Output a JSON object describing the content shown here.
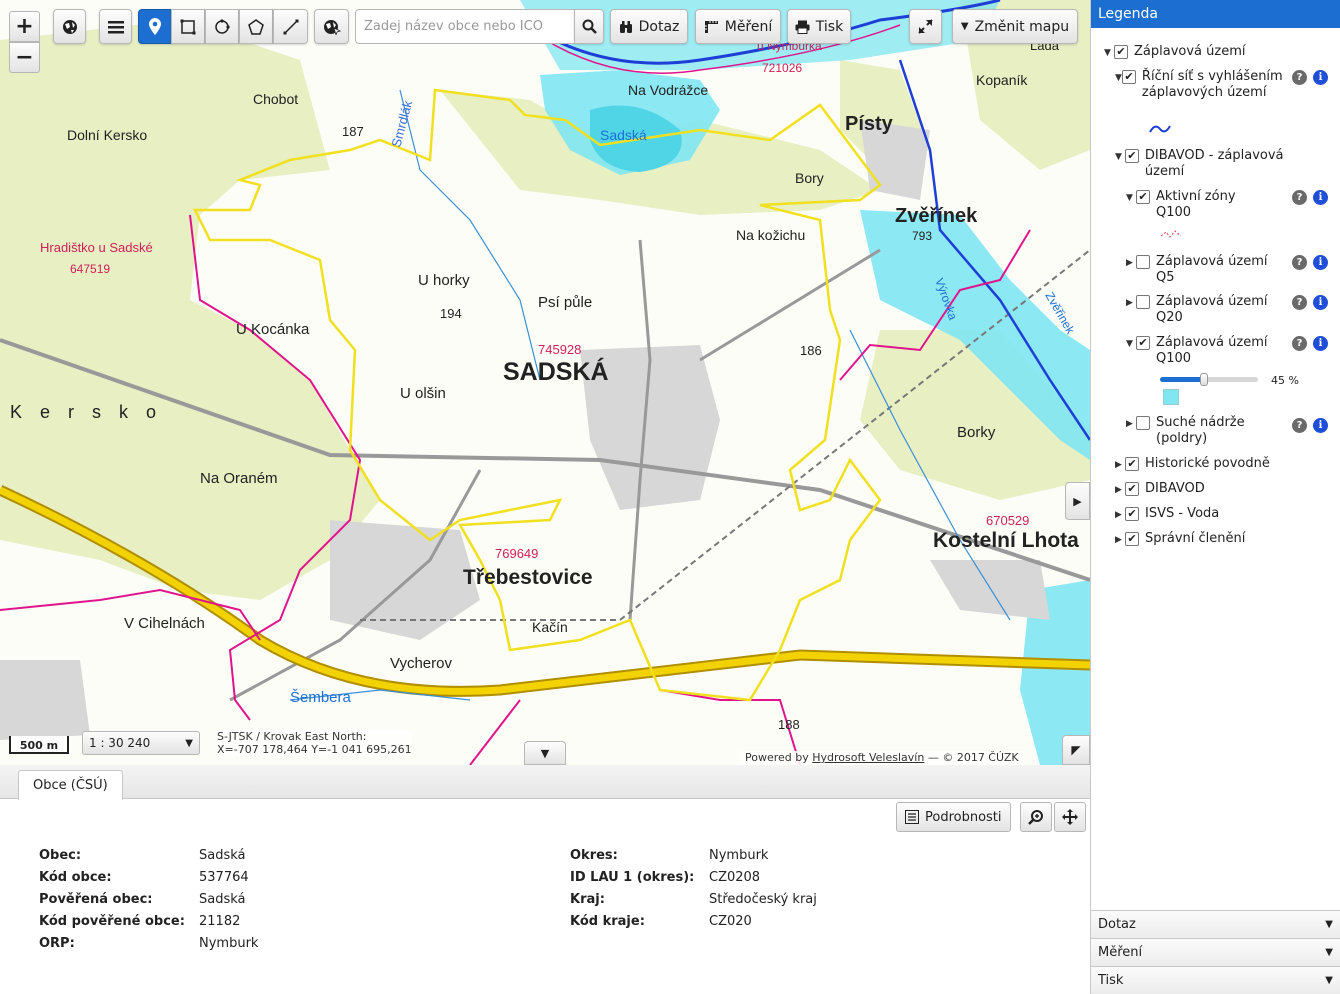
{
  "toolbar": {
    "zoom_in": "+",
    "zoom_out": "−",
    "search_placeholder": "Zadej název obce nebo IČO",
    "query_label": "Dotaz",
    "measure_label": "Měření",
    "print_label": "Tisk",
    "change_map_label": "Změnit mapu"
  },
  "map": {
    "labels": [
      {
        "text": "Hradištko u Sadské"
      },
      {
        "text": "647519"
      },
      {
        "text": "Dolní Kersko"
      },
      {
        "text": "Chobot"
      },
      {
        "text": "187"
      },
      {
        "text": "Smrdlák"
      },
      {
        "text": "Na Vodrážce"
      },
      {
        "text": "Sadská"
      },
      {
        "text": "u Nymburka"
      },
      {
        "text": "721026"
      },
      {
        "text": "Písty"
      },
      {
        "text": "Kopaník"
      },
      {
        "text": "Lada"
      },
      {
        "text": "Bory"
      },
      {
        "text": "Zvěřínek"
      },
      {
        "text": "793"
      },
      {
        "text": "Na kožichu"
      },
      {
        "text": "U horky"
      },
      {
        "text": "194"
      },
      {
        "text": "Psí půle"
      },
      {
        "text": "745928"
      },
      {
        "text": "SADSKÁ"
      },
      {
        "text": "186"
      },
      {
        "text": "U Kocánka"
      },
      {
        "text": "U olšin"
      },
      {
        "text": "Kersko"
      },
      {
        "text": "Na Oraném"
      },
      {
        "text": "Borky"
      },
      {
        "text": "670529"
      },
      {
        "text": "Kostelní Lhota"
      },
      {
        "text": "769649"
      },
      {
        "text": "Třebestovice"
      },
      {
        "text": "Kačín"
      },
      {
        "text": "V Cihelnách"
      },
      {
        "text": "Vycherov"
      },
      {
        "text": "Šembera"
      },
      {
        "text": "188"
      },
      {
        "text": "Výrovka"
      },
      {
        "text": "Zvěřinek"
      }
    ],
    "scale_bar": "500 m",
    "scale_value": "1 : 30 240",
    "coords_line1": "S-JTSK / Krovak East North:",
    "coords_line2": "X=-707 178,464 Y=-1 041 695,261",
    "attribution_prefix": "Powered by ",
    "attribution_link": "Hydrosoft Veleslavín",
    "attribution_suffix": " — © 2017 ČÚZK"
  },
  "bottom": {
    "tab_label": "Obce (ČSÚ)",
    "details_label": "Podrobnosti",
    "left": [
      {
        "k": "Obec:",
        "v": "Sadská"
      },
      {
        "k": "Kód obce:",
        "v": "537764"
      },
      {
        "k": "Pověřená obec:",
        "v": "Sadská"
      },
      {
        "k": "Kód pověřené obce:",
        "v": "21182"
      },
      {
        "k": "ORP:",
        "v": "Nymburk"
      }
    ],
    "right": [
      {
        "k": "Okres:",
        "v": "Nymburk"
      },
      {
        "k": "ID LAU 1 (okres):",
        "v": "CZ0208"
      },
      {
        "k": "Kraj:",
        "v": "Středočeský kraj"
      },
      {
        "k": "Kód kraje:",
        "v": "CZ020"
      }
    ]
  },
  "legend": {
    "title": "Legenda",
    "items": [
      {
        "label": "Záplavová území"
      },
      {
        "label": "Říční síť s vyhlášením záplavových území"
      },
      {
        "label": "DIBAVOD - záplavová území"
      },
      {
        "label": "Aktivní zóny Q100"
      },
      {
        "label": "Záplavová území Q5"
      },
      {
        "label": "Záplavová území Q20"
      },
      {
        "label": "Záplavová území Q100"
      },
      {
        "label": "Suché nádrže (poldry)"
      },
      {
        "label": "Historické povodně"
      },
      {
        "label": "DIBAVOD"
      },
      {
        "label": "ISVS - Voda"
      },
      {
        "label": "Správní členění"
      }
    ],
    "opacity_value": 45,
    "opacity_label": "45 %",
    "accordions": [
      {
        "label": "Dotaz"
      },
      {
        "label": "Měření"
      },
      {
        "label": "Tisk"
      }
    ]
  },
  "colors": {
    "accent": "#1c6fd1",
    "flood_q100": "#7fe6f2",
    "municipal_boundary": "#f0e020",
    "district_boundary": "#e0148c",
    "forest": "#e7efc3",
    "highway": "#f2d200"
  }
}
